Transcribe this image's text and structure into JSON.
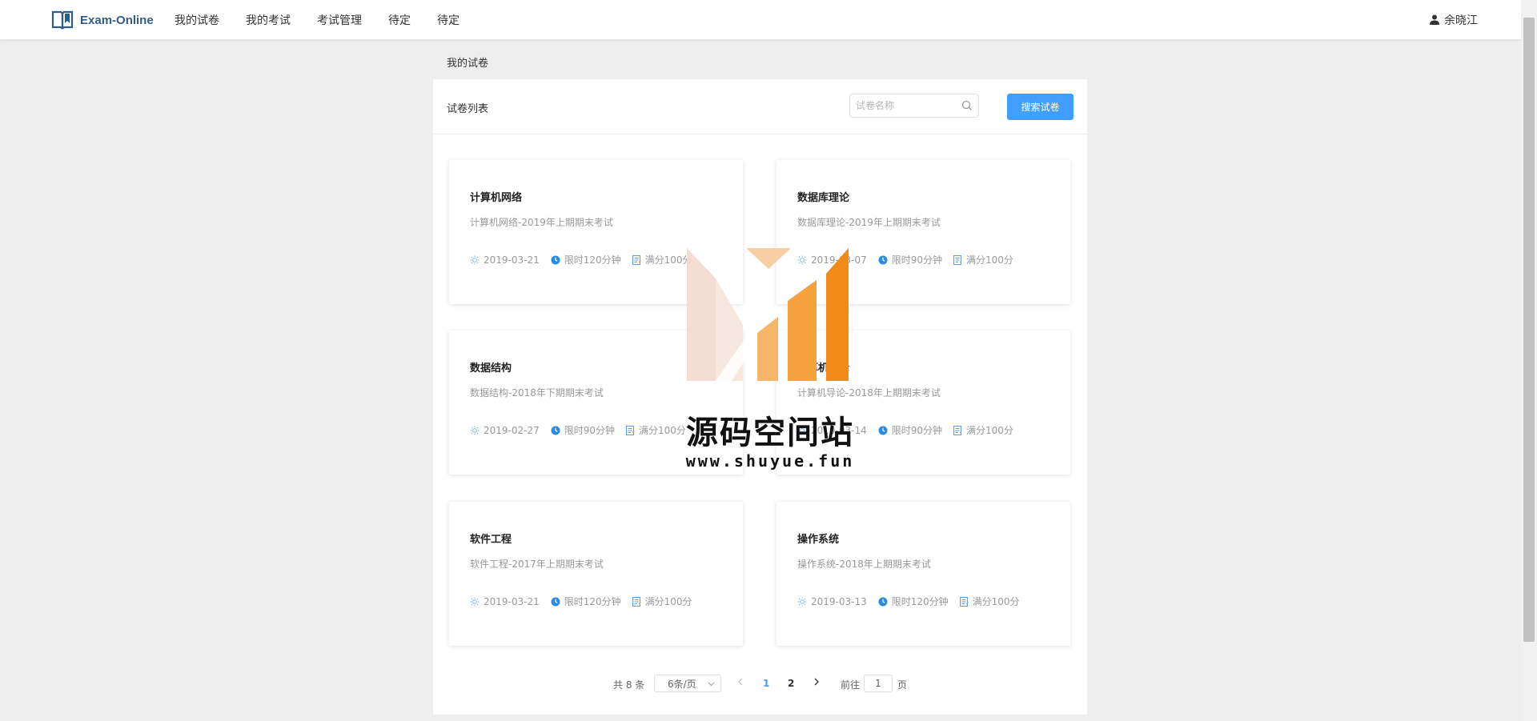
{
  "header": {
    "logo_text": "Exam-Online",
    "nav": [
      "我的试卷",
      "我的考试",
      "考试管理",
      "待定",
      "待定"
    ],
    "user_name": "余晓江"
  },
  "breadcrumb": "我的试卷",
  "panel": {
    "title": "试卷列表",
    "search_placeholder": "试卷名称",
    "search_button": "搜索试卷"
  },
  "cards": [
    {
      "title": "计算机网络",
      "desc": "计算机网络-2019年上期期末考试",
      "date": "2019-03-21",
      "limit": "限时120分钟",
      "score": "满分100分"
    },
    {
      "title": "数据库理论",
      "desc": "数据库理论-2019年上期期末考试",
      "date": "2019-03-07",
      "limit": "限时90分钟",
      "score": "满分100分"
    },
    {
      "title": "数据结构",
      "desc": "数据结构-2018年下期期末考试",
      "date": "2019-02-27",
      "limit": "限时90分钟",
      "score": "满分100分"
    },
    {
      "title": "计算机导论",
      "desc": "计算机导论-2018年上期期末考试",
      "date": "2019-03-14",
      "limit": "限时90分钟",
      "score": "满分100分"
    },
    {
      "title": "软件工程",
      "desc": "软件工程-2017年上期期末考试",
      "date": "2019-03-21",
      "limit": "限时120分钟",
      "score": "满分100分"
    },
    {
      "title": "操作系统",
      "desc": "操作系统-2018年上期期末考试",
      "date": "2019-03-13",
      "limit": "限时120分钟",
      "score": "满分100分"
    }
  ],
  "pagination": {
    "total": "共 8 条",
    "page_size": "6条/页",
    "pages": [
      "1",
      "2"
    ],
    "current_page": "1",
    "goto_label": "前往",
    "goto_value": "1",
    "page_suffix": "页"
  },
  "watermark": {
    "title": "源码空间站",
    "url": "www.shuyue.fun"
  },
  "colors": {
    "primary": "#409eff",
    "logo": "#2f5d8a",
    "watermark_orange": "#f28a1a"
  }
}
